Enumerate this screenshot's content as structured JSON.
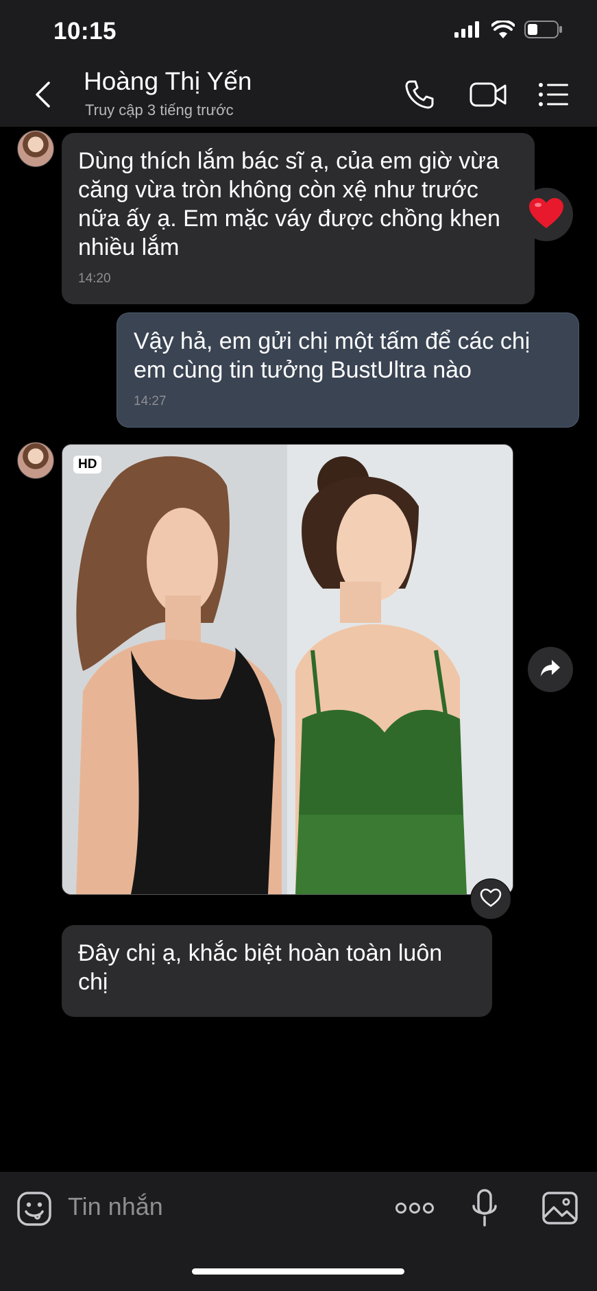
{
  "status_bar": {
    "time": "10:15"
  },
  "header": {
    "contact_name": "Hoàng Thị Yến",
    "last_seen": "Truy cập 3 tiếng trước",
    "icons": [
      "back-icon",
      "phone-icon",
      "video-call-icon",
      "menu-list-icon"
    ]
  },
  "messages": [
    {
      "direction": "incoming",
      "text": "Dùng thích lắm bác sĩ ạ, của em giờ vừa căng vừa tròn không còn xệ như trước nữa ấy ạ. Em mặc váy được chồng khen nhiều lắm",
      "time": "14:20",
      "reaction": "heart"
    },
    {
      "direction": "outgoing",
      "text": "Vậy hả, em gửi chị  một tấm để các chị em cùng tin tưởng BustUltra nào",
      "time": "14:27"
    },
    {
      "direction": "incoming",
      "type": "photo",
      "badge": "HD"
    },
    {
      "direction": "incoming",
      "text": "Đây chị  ạ, khắc biệt hoàn toàn luôn chị"
    }
  ],
  "composer": {
    "placeholder": "Tin nhắn",
    "icons": [
      "emoji-icon",
      "more-icon",
      "microphone-icon",
      "image-icon"
    ]
  },
  "colors": {
    "header_bg": "#1c1c1e",
    "incoming_bubble": "#2c2c2e",
    "outgoing_bubble": "#3a4453",
    "heart": "#e8192c"
  }
}
